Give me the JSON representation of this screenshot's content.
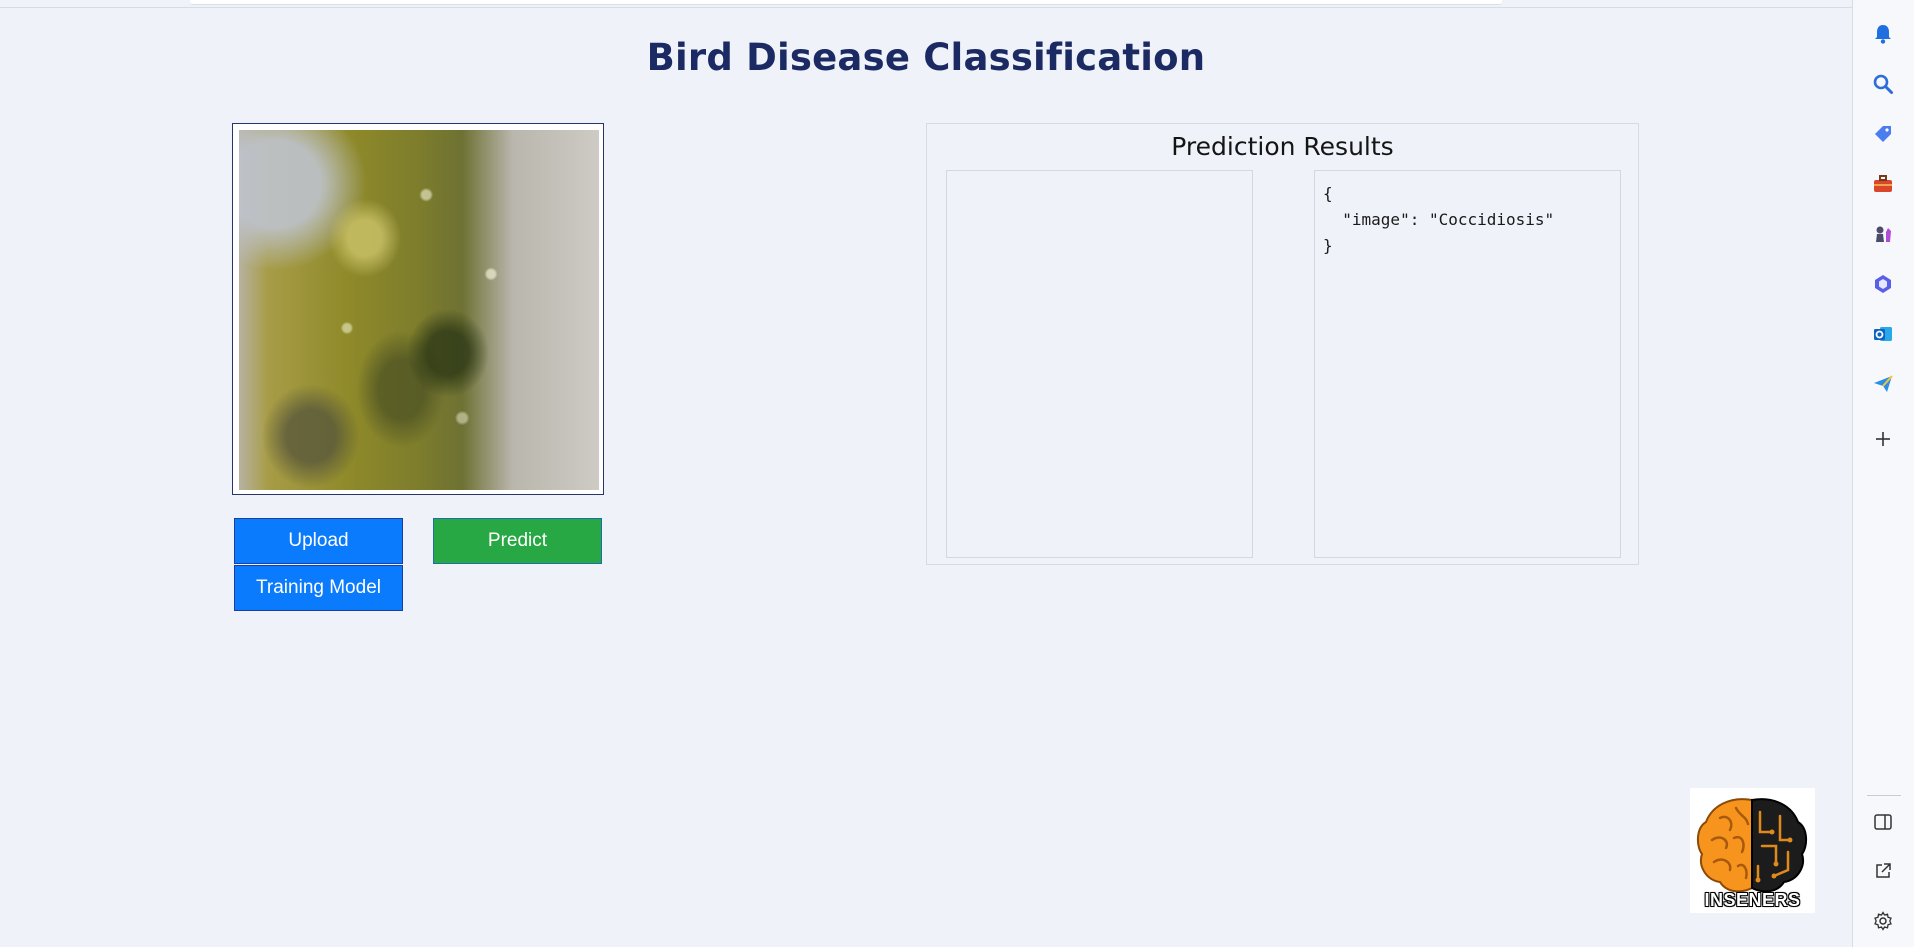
{
  "page": {
    "title": "Bird Disease Classification"
  },
  "controls": {
    "upload_label": "Upload",
    "predict_label": "Predict",
    "training_label": "Training Model"
  },
  "results": {
    "title": "Prediction Results",
    "json_text": "{\n  \"image\": \"Coccidiosis\"\n}"
  },
  "logo": {
    "text": "INSENERS"
  },
  "sidebar": {
    "items": [
      {
        "icon": "bell-icon",
        "color": "#1f6fe0"
      },
      {
        "icon": "search-icon",
        "color": "#2b6ed9"
      },
      {
        "icon": "tag-icon",
        "color": "#4a7df0"
      },
      {
        "icon": "toolbox-icon",
        "color": "#d9462b"
      },
      {
        "icon": "chess-icon",
        "color": "#7b4bd6"
      },
      {
        "icon": "copilot-icon",
        "color": "#5b5fe8"
      },
      {
        "icon": "outlook-icon",
        "color": "#0a64c2"
      },
      {
        "icon": "send-icon",
        "color": "#2a8ee6"
      },
      {
        "icon": "plus-icon",
        "color": "#333333"
      },
      {
        "icon": "sidebar-toggle-icon",
        "color": "#333333"
      },
      {
        "icon": "external-link-icon",
        "color": "#333333"
      },
      {
        "icon": "settings-icon",
        "color": "#333333"
      }
    ]
  }
}
